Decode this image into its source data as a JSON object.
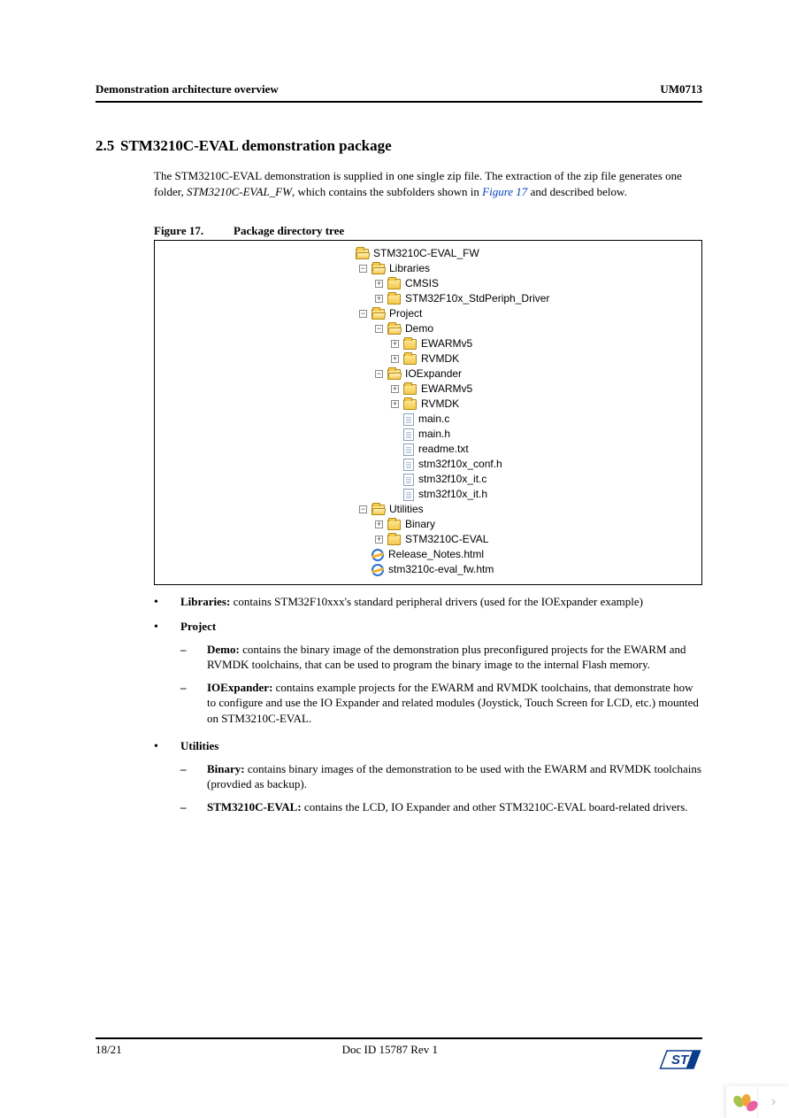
{
  "header": {
    "left": "Demonstration architecture overview",
    "right": "UM0713"
  },
  "section": {
    "num": "2.5",
    "title": "STM3210C-EVAL demonstration package",
    "intro1": "The STM3210C-EVAL demonstration is supplied in one single zip file. The extraction of the zip file generates one folder, ",
    "folder": "STM3210C-EVAL_FW",
    "intro2": ", which contains the subfolders shown in ",
    "figref": "Figure 17",
    "intro3": " and described below."
  },
  "figure": {
    "num": "Figure 17.",
    "caption": "Package directory tree"
  },
  "tree": {
    "root": "STM3210C-EVAL_FW",
    "libraries": "Libraries",
    "cmsis": "CMSIS",
    "stdperiph": "STM32F10x_StdPeriph_Driver",
    "project": "Project",
    "demo": "Demo",
    "ewarm1": "EWARMv5",
    "rvmdk1": "RVMDK",
    "ioexp": "IOExpander",
    "ewarm2": "EWARMv5",
    "rvmdk2": "RVMDK",
    "mainc": "main.c",
    "mainh": "main.h",
    "readme": "readme.txt",
    "conf": "stm32f10x_conf.h",
    "itc": "stm32f10x_it.c",
    "ith": "stm32f10x_it.h",
    "utilities": "Utilities",
    "binary": "Binary",
    "evalboard": "STM3210C-EVAL",
    "relnotes": "Release_Notes.html",
    "fwhtm": "stm3210c-eval_fw.htm"
  },
  "bullets": {
    "libTitle": "Libraries:",
    "libText": " contains STM32F10xxx's standard peripheral drivers (used for the IOExpander example)",
    "projTitle": "Project",
    "demoTitle": "Demo:",
    "demoText": " contains the binary image of the demonstration plus preconfigured projects for the EWARM and RVMDK toolchains, that can be used to program the binary image to the internal Flash memory.",
    "ioTitle": "IOExpander:",
    "ioText": " contains example projects for the EWARM and RVMDK toolchains, that demonstrate how to configure and use the IO Expander and related modules (Joystick, Touch Screen for LCD, etc.) mounted on STM3210C-EVAL.",
    "utilTitle": "Utilities",
    "binTitle": "Binary:",
    "binText": " contains binary images of the demonstration to be used with the EWARM and RVMDK toolchains (provdied as backup).",
    "evalTitle": "STM3210C-EVAL:",
    "evalText": " contains the LCD, IO Expander and other STM3210C-EVAL board-related drivers."
  },
  "footer": {
    "page": "18/21",
    "doc": "Doc ID 15787 Rev 1"
  },
  "exp": {
    "plus": "+",
    "minus": "−"
  },
  "corner": {
    "chev": "›"
  }
}
